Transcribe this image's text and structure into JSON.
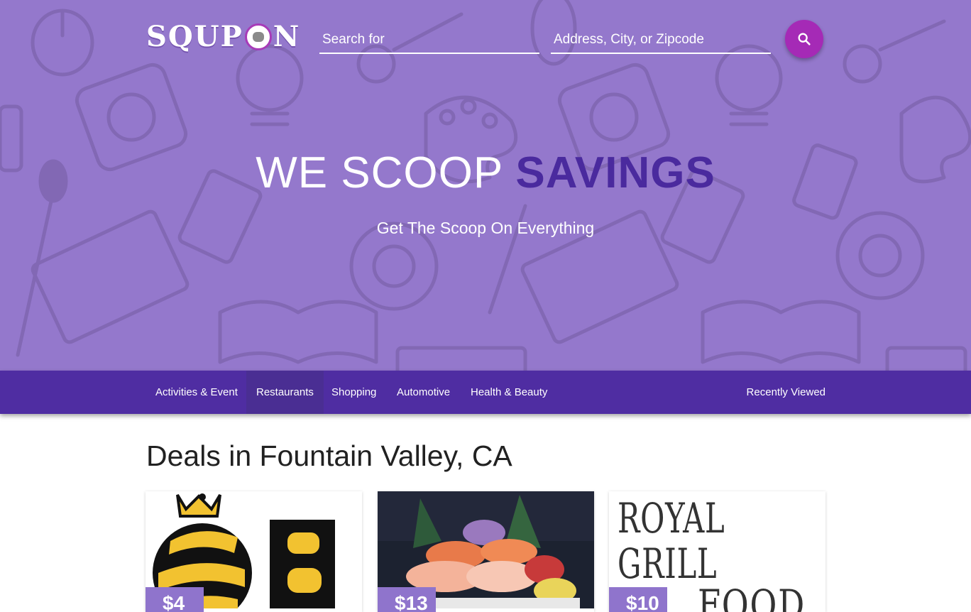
{
  "header": {
    "logo_text_left": "SQUP",
    "logo_text_right": "N",
    "search_placeholder": "Search for",
    "address_placeholder": "Address, City, or Zipcode"
  },
  "hero": {
    "headline_plain": "WE SCOOP",
    "headline_strong": "SAVINGS",
    "subheadline": "Get The Scoop On Everything"
  },
  "nav": {
    "items": [
      {
        "label": "Activities & Event"
      },
      {
        "label": "Restaurants"
      },
      {
        "label": "Shopping"
      },
      {
        "label": "Automotive"
      },
      {
        "label": "Health & Beauty"
      }
    ],
    "active": "Restaurants",
    "recently_viewed": "Recently Viewed"
  },
  "deals": {
    "title": "Deals in Fountain Valley, CA",
    "cards": [
      {
        "image": "qb-bee-logo",
        "price": "$4"
      },
      {
        "image": "sashimi-platter",
        "price": "$13"
      },
      {
        "image": "royal-grill-food-logo",
        "image_text": "ROYAL GRILL",
        "image_text_2": "FOOD",
        "price": "$10"
      }
    ]
  },
  "colors": {
    "hero_bg": "#9478cc",
    "nav_bg": "#4f2da2",
    "accent": "#a52ab6",
    "headline_strong": "#4a2a9e",
    "price_tag": "#8f74cc"
  },
  "icons": [
    "search-icon"
  ]
}
